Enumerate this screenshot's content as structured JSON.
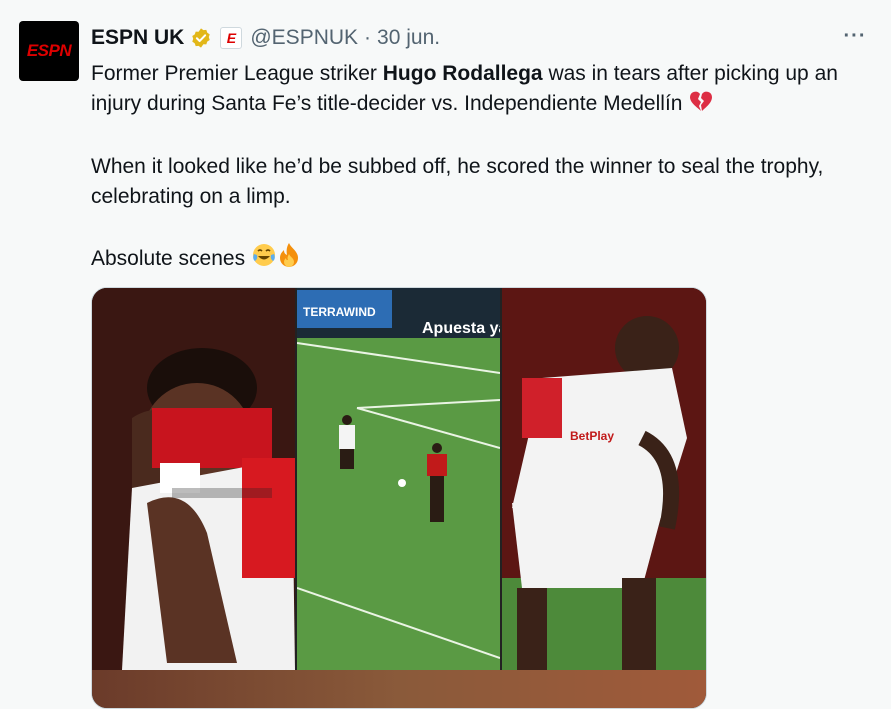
{
  "tweet": {
    "account_name": "ESPN UK",
    "avatar_text": "ESPN",
    "affiliate_badge": "E",
    "handle": "@ESPNUK",
    "separator": "·",
    "timestamp": "30 jun.",
    "more_label": "···",
    "line1_pre": "Former Premier League striker ",
    "line1_bold": "Hugo Rodallega",
    "line1_post": " was in tears after picking up an injury during Santa Fe’s title-decider vs. Independiente Medellín",
    "line2": "When it looked like he’d be subbed off, he scored the winner to seal the trophy, celebrating on a limp.",
    "line3": "Absolute scenes",
    "icons": {
      "verified": "verified-gold-badge-icon",
      "broken_heart": "broken-heart-icon",
      "tears_of_joy": "tears-of-joy-emoji",
      "fire": "fire-emoji",
      "more": "more-options-icon"
    }
  },
  "media": {
    "panels": [
      {
        "label": "",
        "depicts": "player-crying-photo"
      },
      {
        "label": "",
        "depicts": "match-footage-photo"
      },
      {
        "label": "",
        "depicts": "player-limping-photo"
      }
    ]
  },
  "colors": {
    "background": "#f7f9f9",
    "text": "#0f1419",
    "secondary_text": "#536471",
    "verified_gold": "#e2b719",
    "espn_red": "#dd0000"
  }
}
